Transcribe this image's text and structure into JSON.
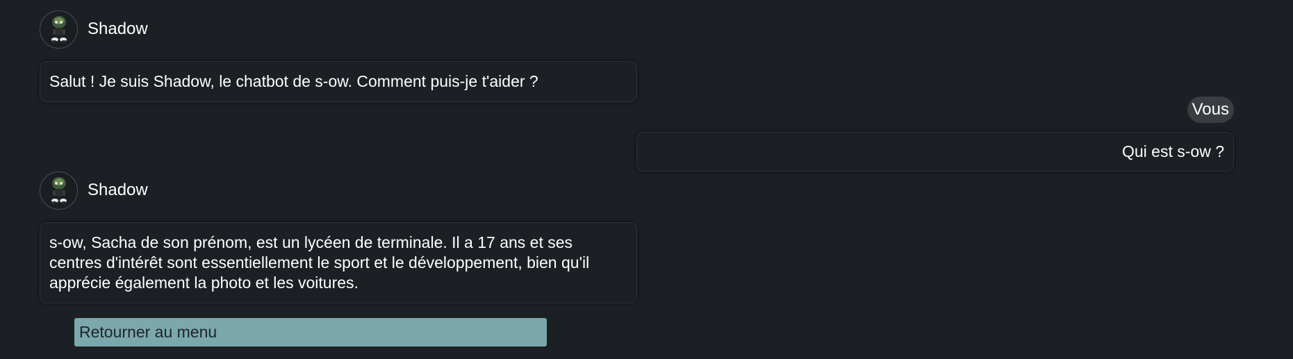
{
  "bot": {
    "name": "Shadow",
    "avatar_icon": "shadow-character-avatar"
  },
  "user": {
    "label": "Vous"
  },
  "messages": [
    {
      "sender": "bot",
      "text": "Salut ! Je suis Shadow, le chatbot de s-ow. Comment puis-je t'aider ?"
    },
    {
      "sender": "user",
      "text": "Qui est s-ow ?"
    },
    {
      "sender": "bot",
      "text": "s-ow, Sacha de son prénom, est un lycéen de terminale. Il a 17 ans et ses centres d'intérêt sont essentiellement le sport et le développement, bien qu'il apprécie également la photo et les voitures."
    }
  ],
  "actions": {
    "back_to_menu_label": "Retourner au menu"
  },
  "colors": {
    "background": "#1c1f24",
    "bubble_border": "#2f333b",
    "user_tag_bg": "#3a3d42",
    "menu_button_bg": "#7aa8ac",
    "menu_button_text": "#1f2428"
  }
}
